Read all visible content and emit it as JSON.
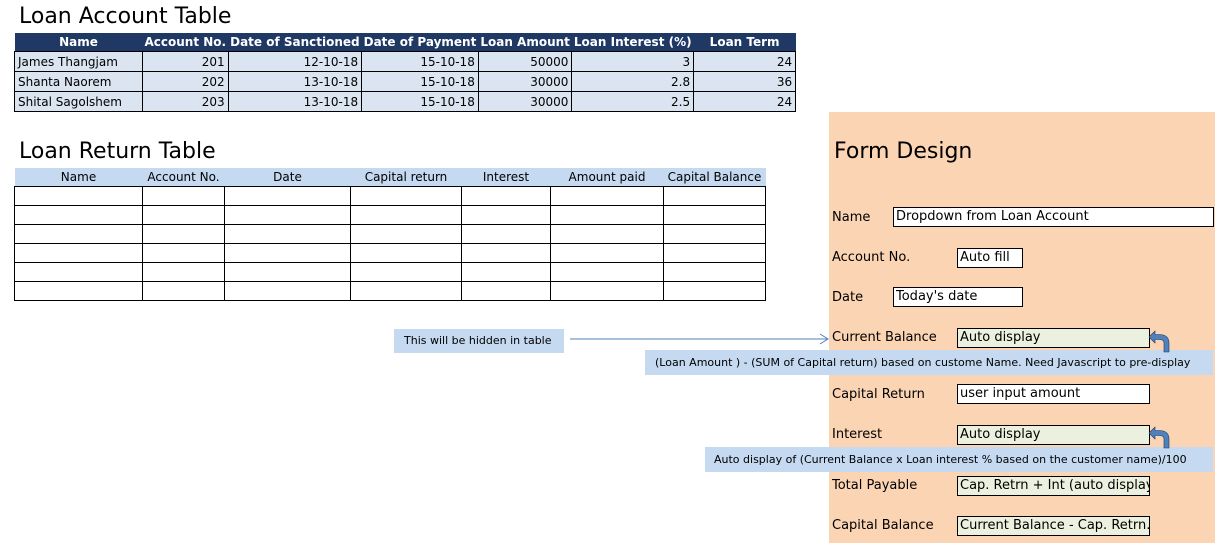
{
  "loan_account": {
    "title": "Loan Account Table",
    "headers": [
      "Name",
      "Account No.",
      "Date of Sanctioned",
      "Date of Payment",
      "Loan Amount",
      "Loan Interest (%)",
      "Loan Term"
    ],
    "rows": [
      [
        "James Thangjam",
        "201",
        "12-10-18",
        "15-10-18",
        "50000",
        "3",
        "24"
      ],
      [
        "Shanta Naorem",
        "202",
        "13-10-18",
        "15-10-18",
        "30000",
        "2.8",
        "36"
      ],
      [
        "Shital Sagolshem",
        "203",
        "13-10-18",
        "15-10-18",
        "30000",
        "2.5",
        "24"
      ]
    ]
  },
  "loan_return": {
    "title": "Loan Return Table",
    "headers": [
      "Name",
      "Account No.",
      "Date",
      "Capital return",
      "Interest",
      "Amount paid",
      "Capital Balance"
    ]
  },
  "form": {
    "title": "Form Design",
    "name_label": "Name",
    "name_value": "Dropdown from Loan Account",
    "account_label": "Account No.",
    "account_value": "Auto fill",
    "date_label": "Date",
    "date_value": "Today's date",
    "current_balance_label": "Current Balance",
    "current_balance_value": "Auto display",
    "capital_return_label": "Capital Return",
    "capital_return_value": "user input amount",
    "interest_label": "Interest",
    "interest_value": "Auto display",
    "total_payable_label": "Total Payable",
    "total_payable_value": "Cap. Retrn + Int (auto display)",
    "capital_balance_label": "Capital Balance",
    "capital_balance_value": "Current Balance - Cap. Retrn."
  },
  "notes": {
    "hidden": "This will be hidden in table",
    "balance_formula": "(Loan Amount ) - (SUM of Capital return) based on custome Name.  Need Javascript to pre-display",
    "interest_formula": "Auto display of (Current Balance x Loan interest % based on the customer name)/100"
  },
  "colors": {
    "header_dark": "#1f3864",
    "row_fill": "#dbe5f1",
    "return_header": "#c5d9f1",
    "form_panel": "#fbd4b4",
    "arrow": "#4f81bd"
  }
}
